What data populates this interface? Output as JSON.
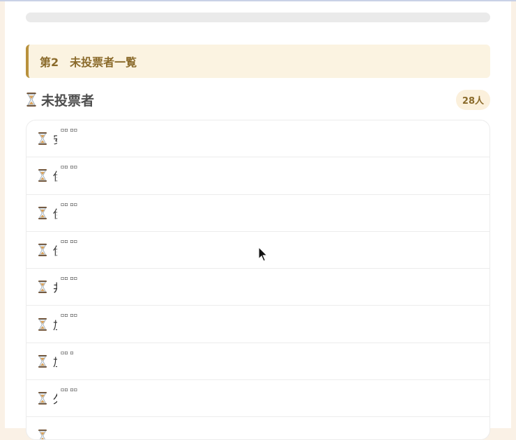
{
  "progress": {
    "percent": 0
  },
  "section": {
    "title": "第2　未投票者一覧"
  },
  "unvoted": {
    "title": "未投票者",
    "count": "28人",
    "icon": "hourglass-icon",
    "rows": [
      {
        "name": "安",
        "superscript": "▫▫ ▫▫"
      },
      {
        "name": "伊",
        "superscript": "▫▫ ▫▫"
      },
      {
        "name": "伊",
        "superscript": "▫▫ ▫▫"
      },
      {
        "name": "伊",
        "superscript": "▫▫ ▫▫"
      },
      {
        "name": "井",
        "superscript": "▫▫ ▫▫"
      },
      {
        "name": "加",
        "superscript": "▫▫ ▫▫"
      },
      {
        "name": "加",
        "superscript": "▫▫ ▫"
      },
      {
        "name": "久",
        "superscript": "▫▫ ▫▫"
      },
      {
        "name": "",
        "superscript": ""
      }
    ]
  },
  "colors": {
    "accent": "#b8913c",
    "header_bg": "#fbf3e1",
    "page_bg": "#faf1e6"
  }
}
